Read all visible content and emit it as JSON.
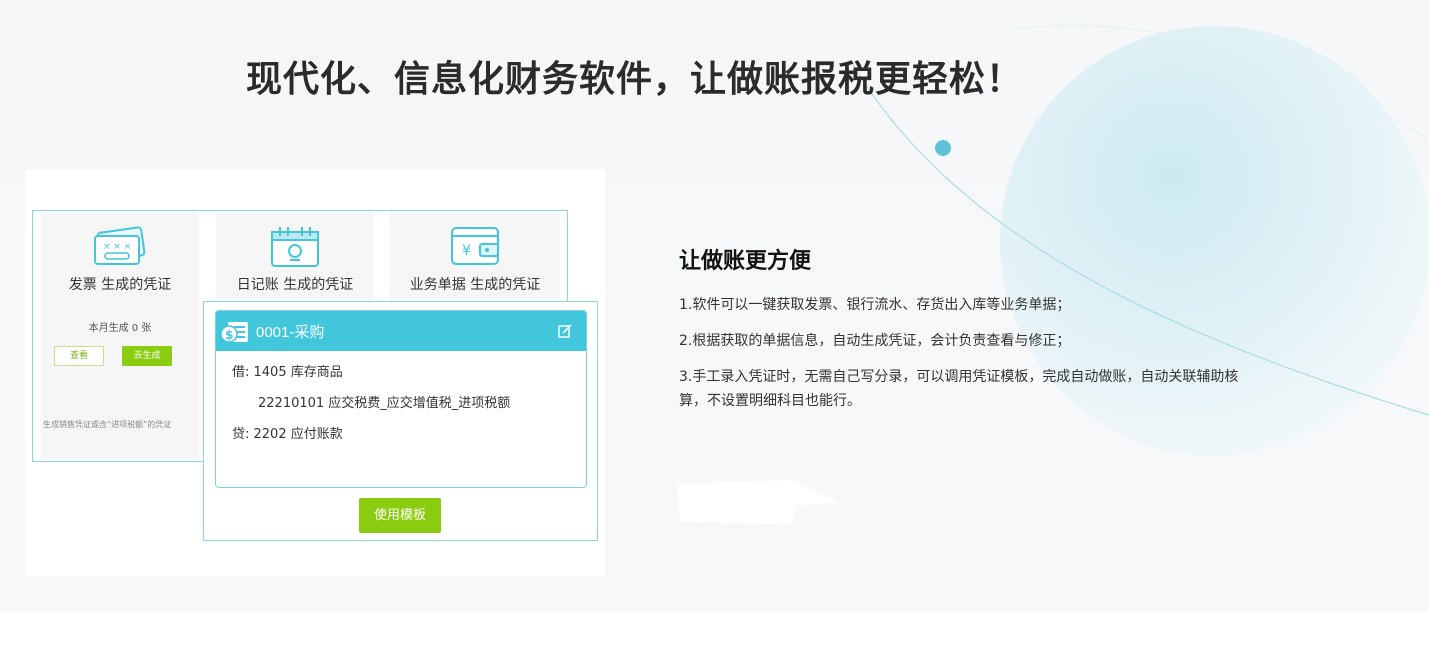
{
  "hero": {
    "title": "现代化、信息化财务软件，让做账报税更轻松！"
  },
  "voucher_screenshot": {
    "columns": [
      {
        "label": "发票 生成的凭证",
        "icon": "invoice-icon",
        "month_count": "本月生成 0 张",
        "view_label": "查看",
        "generate_label": "去生成",
        "note": "生成销售凭证或含“进项税额”的凭证"
      },
      {
        "label": "日记账 生成的凭证",
        "icon": "calendar-icon"
      },
      {
        "label": "业务单据 生成的凭证",
        "icon": "wallet-icon"
      }
    ],
    "voucher": {
      "title": "0001-采购",
      "icon": "money-document-icon",
      "edit_icon": "edit-icon",
      "debit": "借:  1405 库存商品",
      "debit_sub": "22210101 应交税费_应交增值税_进项税额",
      "credit": "贷:  2202 应付账款"
    },
    "template_button": "使用模板"
  },
  "feature": {
    "title": "让做账更方便",
    "lines": [
      "1.软件可以一键获取发票、银行流水、存货出入库等业务单据；",
      "2.根据获取的单据信息，自动生成凭证，会计负责查看与修正；",
      "3.手工录入凭证时，无需自己写分录，可以调用凭证模板，完成自动做账，自动关联辅助核算，不设置明细科目也能行。"
    ]
  },
  "colors": {
    "accent_teal": "#41c6dc",
    "accent_green": "#8ccc10",
    "frame_border": "#8fd3df"
  }
}
